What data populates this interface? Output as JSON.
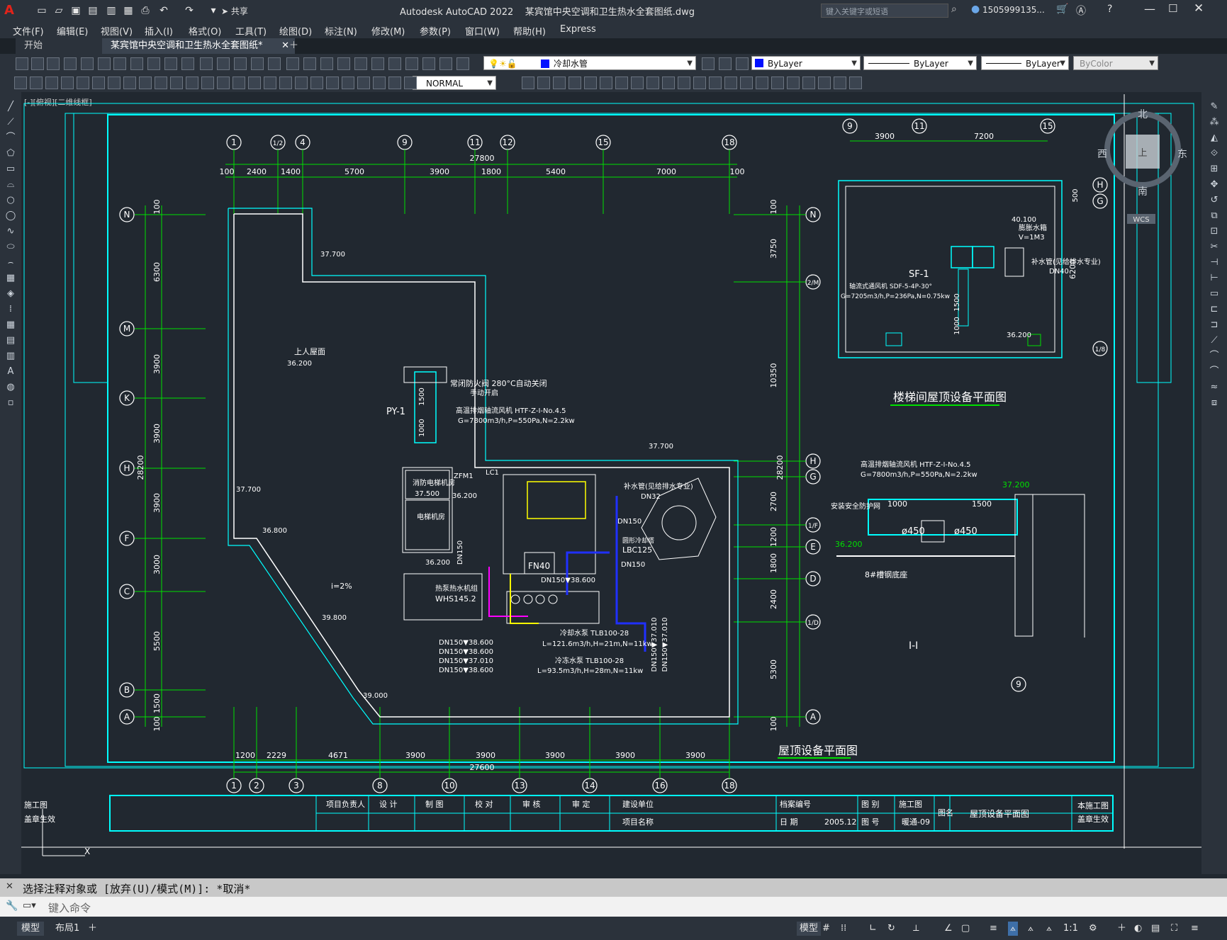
{
  "app": {
    "title": "Autodesk AutoCAD 2022",
    "filename": "某宾馆中央空调和卫生热水全套图纸.dwg",
    "share": "共享",
    "search_placeholder": "键入关键字或短语",
    "user": "1505999135...",
    "logo": "A"
  },
  "menu": [
    "文件(F)",
    "编辑(E)",
    "视图(V)",
    "插入(I)",
    "格式(O)",
    "工具(T)",
    "绘图(D)",
    "标注(N)",
    "修改(M)",
    "参数(P)",
    "窗口(W)",
    "帮助(H)",
    "Express"
  ],
  "tabs": {
    "start": "开始",
    "doc": "某宾馆中央空调和卫生热水全套图纸*"
  },
  "toolbar": {
    "layer": "冷却水管",
    "color": "ByLayer",
    "linetype": "ByLayer",
    "lineweight": "ByLayer",
    "plotstyle": "ByColor",
    "dimstyle": "NORMAL"
  },
  "viewport_label": "[-][俯视][二维线框]",
  "viewcube": {
    "north": "北",
    "south": "南",
    "east": "东",
    "west": "西",
    "top": "上",
    "wcs": "WCS"
  },
  "drawing": {
    "grid_top": [
      "1",
      "1/2",
      "4",
      "9",
      "11",
      "12",
      "15",
      "18"
    ],
    "dims_top": [
      "100",
      "2400",
      "1400",
      "5700",
      "3900",
      "1800",
      "5400",
      "7000",
      "100"
    ],
    "dim_top_total": "27800",
    "grid_bottom": [
      "1",
      "2",
      "3",
      "8",
      "10",
      "13",
      "14",
      "16",
      "18"
    ],
    "dims_bottom": [
      "1200",
      "2229",
      "4671",
      "3900",
      "3900",
      "3900",
      "3900",
      "3900"
    ],
    "dim_bottom_total": "27600",
    "grid_left": [
      "N",
      "M",
      "K",
      "H",
      "F",
      "C",
      "B",
      "A"
    ],
    "dims_left": [
      "100",
      "6300",
      "3900",
      "3900",
      "3900",
      "3000",
      "5500",
      "1500",
      "100"
    ],
    "dim_left_total": "28200",
    "grid_right": [
      "N",
      "2/M",
      "H",
      "G",
      "1/F",
      "E",
      "D",
      "1/D",
      "A"
    ],
    "dims_right": [
      "100",
      "3750",
      "10350",
      "2700",
      "1200",
      "1800",
      "2400",
      "5300",
      "100"
    ],
    "dim_right_total": "28200",
    "elevations": [
      "37.700",
      "36.200",
      "37.700",
      "36.800",
      "39.800",
      "39.000",
      "37.500",
      "36.200",
      "36.200",
      "37.700"
    ],
    "labels": {
      "roof_exit": "上人屋面",
      "py1": "PY-1",
      "fire_valve": "常闭防火阀 280°C自动关闭",
      "fire_valve_2": "手动开启",
      "fan_text": "高温排烟轴流风机 HTF-Z-I-No.4.5",
      "fan_spec": "G=7800m3/h,P=550Pa,N=2.2kw",
      "d1": "1500",
      "d2": "1000",
      "slope": "i=2%",
      "fire_machine": "消防电梯机房",
      "elevator_machine": "电梯机房",
      "zfm1": "ZFM1",
      "lc1": "LC1",
      "hot_water_unit": "热泵热水机组",
      "whs": "WHS145.2",
      "fn40": "FN40",
      "dn150": "DN150",
      "dn32": "DN32",
      "makeup": "补水管(见给排水专业)",
      "cooling_tower": "圆形冷却塔",
      "lbc": "LBC125",
      "pump1": "冷却水泵 TLB100-28",
      "pump1_spec": "L=121.6m3/h,H=21m,N=11kw",
      "pump2": "冷冻水泵 TLB100-28",
      "pump2_spec": "L=93.5m3/h,H=28m,N=11kw",
      "pipe_list": [
        "DN150▼38.600",
        "DN150▼38.600",
        "DN150▼37.010",
        "DN150▼38.600"
      ],
      "dn150_el": "DN150▼38.600",
      "vert1": "DN150▼37.010",
      "vert2": "DN150▼37.010",
      "sf1": "SF-1",
      "sf1_spec": "轴流式通风机 SDF-5-4P-30°",
      "sf1_spec2": "G=7205m3/h,P=236Pa,N=0.75kw",
      "tank": "膨胀水箱",
      "tank_v": "V=1M3",
      "dn40": "DN40",
      "tank_el": "40.100",
      "makeup2": "补水管(见给排水专业)",
      "stair_title": "楼梯间屋顶设备平面图",
      "roof_title": "屋顶设备平面图",
      "section_title": "I-I",
      "safety_net": "安装安全防护网",
      "d450a": "ø450",
      "d450b": "ø450",
      "rubber": "8#槽钢底座",
      "stair_dims": [
        "3900",
        "7200"
      ],
      "stair_grid": [
        "9",
        "11",
        "15",
        "H",
        "G",
        "1/8"
      ],
      "stair_height": "6200",
      "stair_d500": "500",
      "sec_dims": [
        "1000",
        "1500"
      ],
      "sec_el1": "37.200",
      "sec_el2": "36.200",
      "sec_grid": "9",
      "stair_el": "36.200",
      "sec_fan": "高温排烟轴流风机 HTF-Z-I-No.4.5",
      "sec_fan_spec": "G=7800m3/h,P=550Pa,N=2.2kw"
    },
    "titleblock": {
      "c1": "项目负责人",
      "c2": "设 计",
      "c3": "制 图",
      "c4": "校 对",
      "c5": "审 核",
      "c6": "审 定",
      "c7": "建设单位",
      "c8": "项目名称",
      "c9": "档案编号",
      "c10": "日 期",
      "c11": "图 别",
      "c12": "施工图",
      "c13": "图 号",
      "c14": "暖通-09",
      "c15": "图名",
      "c16": "屋顶设备平面图",
      "c17": "本施工图",
      "c18": "盖章生效",
      "date": "2005.12",
      "left1": "施工图",
      "left2": "盖章生效"
    }
  },
  "command": {
    "history": "选择注释对象或 [放弃(U)/模式(M)]: *取消*",
    "placeholder": "键入命令"
  },
  "status": {
    "model": "模型",
    "layout1": "布局1",
    "scale": "1:1"
  }
}
